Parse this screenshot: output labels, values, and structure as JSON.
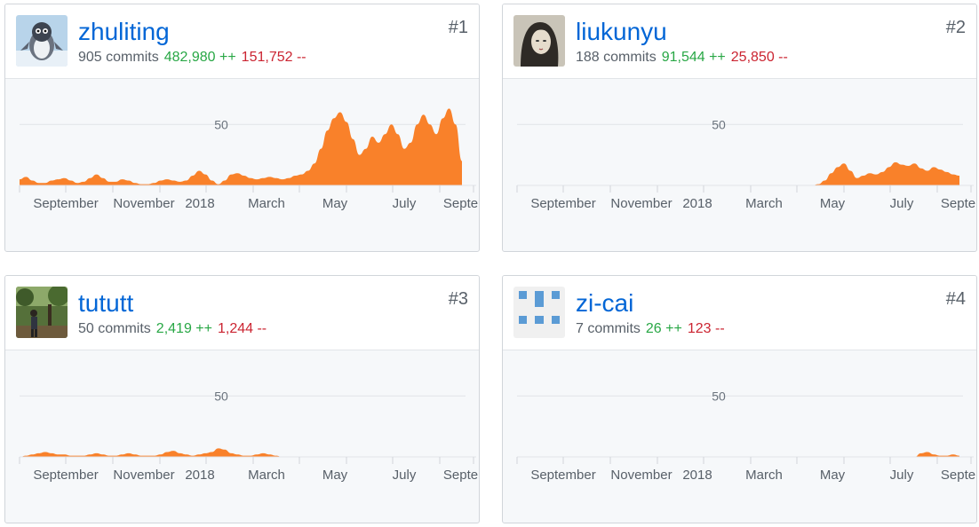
{
  "contributors": [
    {
      "username": "zhuliting",
      "rank": "#1",
      "commits": "905 commits",
      "additions": "482,980 ++",
      "deletions": "151,752 --",
      "avatar": "penguin-avatar-icon"
    },
    {
      "username": "liukunyu",
      "rank": "#2",
      "commits": "188 commits",
      "additions": "91,544 ++",
      "deletions": "25,850 --",
      "avatar": "portrait-avatar-icon"
    },
    {
      "username": "tututt",
      "rank": "#3",
      "commits": "50 commits",
      "additions": "2,419 ++",
      "deletions": "1,244 --",
      "avatar": "forest-photo-avatar-icon"
    },
    {
      "username": "zi-cai",
      "rank": "#4",
      "commits": "7 commits",
      "additions": "26 ++",
      "deletions": "123 --",
      "avatar": "identicon-avatar-icon"
    }
  ],
  "colors": {
    "area": "#f9812a",
    "link": "#0366d6",
    "additions": "#28a745",
    "deletions": "#cb2431"
  },
  "chart_data": [
    {
      "type": "area",
      "x_tick_labels": [
        "September",
        "November",
        "2018",
        "March",
        "May",
        "July",
        "Septer"
      ],
      "y_gridline_label": "50",
      "ylim": [
        0,
        80
      ],
      "weeks": 52,
      "series": [
        {
          "values": [
            5,
            7,
            4,
            2,
            2,
            4,
            5,
            6,
            4,
            2,
            3,
            6,
            9,
            6,
            3,
            3,
            5,
            4,
            2,
            1,
            1,
            2,
            4,
            5,
            4,
            3,
            4,
            8,
            12,
            9,
            4,
            1,
            4,
            9,
            10,
            8,
            6,
            5,
            6,
            7,
            6,
            5,
            6,
            8,
            9,
            12,
            18,
            30,
            45,
            55,
            60,
            52,
            38,
            25,
            30,
            40,
            35,
            42,
            50,
            42,
            30,
            35,
            50,
            58,
            50,
            42,
            55,
            63,
            50,
            20
          ]
        }
      ]
    },
    {
      "type": "area",
      "x_tick_labels": [
        "September",
        "November",
        "2018",
        "March",
        "May",
        "July",
        "Septer"
      ],
      "y_gridline_label": "50",
      "ylim": [
        0,
        80
      ],
      "series": [
        {
          "values": [
            0,
            0,
            0,
            0,
            0,
            0,
            0,
            0,
            0,
            0,
            0,
            0,
            0,
            0,
            0,
            0,
            0,
            0,
            0,
            0,
            0,
            0,
            0,
            0,
            0,
            0,
            0,
            0,
            0,
            0,
            0,
            0,
            0,
            0,
            0,
            0,
            0,
            0,
            0,
            0,
            0,
            0,
            0,
            0,
            0,
            0,
            0,
            1,
            4,
            10,
            15,
            18,
            12,
            6,
            8,
            10,
            9,
            11,
            15,
            19,
            17,
            16,
            18,
            14,
            12,
            15,
            13,
            11,
            9,
            8
          ]
        }
      ]
    },
    {
      "type": "area",
      "x_tick_labels": [
        "September",
        "November",
        "2018",
        "March",
        "May",
        "July",
        "Septer"
      ],
      "y_gridline_label": "50",
      "ylim": [
        0,
        80
      ],
      "series": [
        {
          "values": [
            0,
            1,
            2,
            3,
            4,
            3,
            2,
            2,
            1,
            1,
            1,
            2,
            3,
            2,
            1,
            1,
            2,
            3,
            2,
            1,
            1,
            1,
            2,
            4,
            5,
            3,
            2,
            1,
            2,
            3,
            4,
            7,
            6,
            3,
            2,
            1,
            1,
            2,
            3,
            2,
            1,
            0,
            0,
            0,
            0,
            0,
            0,
            0,
            0,
            0,
            0,
            0,
            0,
            0,
            0,
            0,
            0,
            0,
            0,
            0,
            0,
            0,
            0,
            0,
            0,
            0,
            0,
            0,
            0,
            0
          ]
        }
      ]
    },
    {
      "type": "area",
      "x_tick_labels": [
        "September",
        "November",
        "2018",
        "March",
        "May",
        "July",
        "Septer"
      ],
      "y_gridline_label": "50",
      "ylim": [
        0,
        80
      ],
      "series": [
        {
          "values": [
            0,
            0,
            0,
            0,
            0,
            0,
            0,
            0,
            0,
            0,
            0,
            0,
            0,
            0,
            0,
            0,
            0,
            0,
            0,
            0,
            0,
            0,
            0,
            0,
            0,
            0,
            0,
            0,
            0,
            0,
            0,
            0,
            0,
            0,
            0,
            0,
            0,
            0,
            0,
            0,
            0,
            0,
            0,
            0,
            0,
            0,
            0,
            0,
            0,
            0,
            0,
            0,
            0,
            0,
            0,
            0,
            0,
            0,
            0,
            0,
            0,
            0,
            0,
            3,
            4,
            2,
            1,
            1,
            2,
            1
          ]
        }
      ]
    }
  ]
}
